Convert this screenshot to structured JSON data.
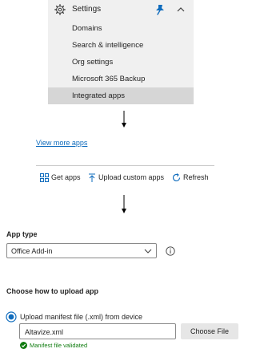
{
  "nav": {
    "title": "Settings",
    "items": [
      {
        "label": "Domains"
      },
      {
        "label": "Search & intelligence"
      },
      {
        "label": "Org settings"
      },
      {
        "label": "Microsoft 365 Backup"
      },
      {
        "label": "Integrated apps",
        "active": true
      }
    ],
    "icons": [
      "gear-icon",
      "pin-icon",
      "chevron-up-icon"
    ]
  },
  "view_more_link": "View more apps",
  "toolbar": {
    "get_apps": "Get apps",
    "upload_custom_apps": "Upload custom apps",
    "refresh": "Refresh"
  },
  "app_type": {
    "label": "App type",
    "selected": "Office Add-in"
  },
  "upload": {
    "heading": "Choose how to upload app",
    "option_label": "Upload manifest file (.xml) from device",
    "file_value": "Altavize.xml",
    "choose_button": "Choose File",
    "status": "Manifest file validated"
  },
  "colors": {
    "link": "#0f6cbd",
    "pin": "#0f6cbd",
    "success": "#107c10",
    "nav_bg": "#f0f0f0",
    "nav_active_bg": "#d6d6d6"
  }
}
